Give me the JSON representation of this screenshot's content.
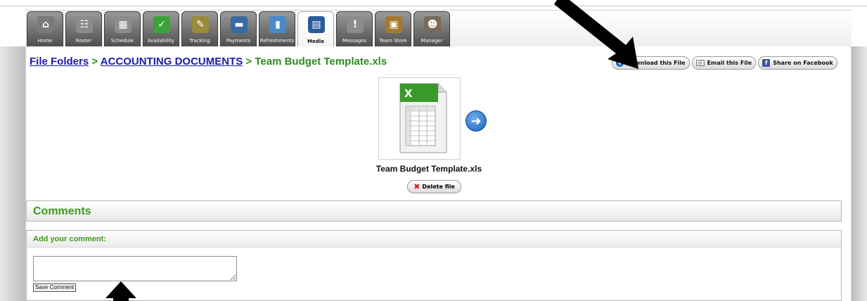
{
  "tabs": [
    {
      "label": "Home",
      "icon": "home-icon",
      "color": "#7a7a7a"
    },
    {
      "label": "Roster",
      "icon": "roster-icon",
      "color": "#8c8c8c"
    },
    {
      "label": "Schedule",
      "icon": "calendar-icon",
      "color": "#8c8c8c"
    },
    {
      "label": "Availability",
      "icon": "checkmark-icon",
      "color": "#3aa43a"
    },
    {
      "label": "Tracking",
      "icon": "clipboard-icon",
      "color": "#9a8a3a"
    },
    {
      "label": "Payments",
      "icon": "payment-card-icon",
      "color": "#3a6aa4"
    },
    {
      "label": "Refreshments",
      "icon": "cup-icon",
      "color": "#4a8ac8"
    },
    {
      "label": "Media",
      "icon": "film-icon",
      "color": "#2a5a9a"
    },
    {
      "label": "Messages",
      "icon": "speech-bubble-icon",
      "color": "#8c8c8c"
    },
    {
      "label": "Team Store",
      "icon": "shopping-bag-icon",
      "color": "#a47a2a"
    },
    {
      "label": "Manager",
      "icon": "person-icon",
      "color": "#7a6a5a"
    }
  ],
  "active_tab": "Media",
  "breadcrumb": {
    "folders": "File Folders",
    "folder": "ACCOUNTING DOCUMENTS",
    "sep": ">",
    "current": "Team Budget Template.xls"
  },
  "actions": {
    "download": "Download this File",
    "email": "Email this File",
    "facebook": "Share on Facebook"
  },
  "file": {
    "name": "Team Budget Template.xls",
    "delete_label": "Delete file"
  },
  "comments": {
    "title": "Comments",
    "add_label": "Add your comment:",
    "input_value": "",
    "save_label": "Save Comment"
  }
}
